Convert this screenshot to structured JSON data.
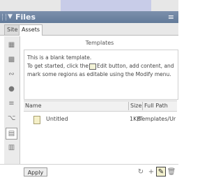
{
  "panel": {
    "title": "Files",
    "expand_arrow": "▼",
    "options_icon": "≡"
  },
  "tabs": [
    {
      "label": "Site"
    },
    {
      "label": "Assets"
    }
  ],
  "categories": [
    {
      "icon": "images-icon"
    },
    {
      "icon": "colors-icon"
    },
    {
      "icon": "urls-icon"
    },
    {
      "icon": "flash-icon"
    },
    {
      "icon": "movies-icon"
    },
    {
      "icon": "scripts-icon"
    },
    {
      "icon": "templates-icon"
    },
    {
      "icon": "library-icon"
    }
  ],
  "content": {
    "title": "Templates",
    "preview_lines": [
      "This is a blank template.",
      "To get started, click the",
      "Edit button, add content, and",
      "mark some regions as editable using the Modify menu."
    ],
    "columns": {
      "name": "Name",
      "size": "Size",
      "path": "Full Path"
    },
    "rows": [
      {
        "name": "Untitled",
        "size": "1KB",
        "path": "/Templates/Ur"
      }
    ]
  },
  "bottom": {
    "apply_label": "Apply",
    "refresh_glyph": "↻",
    "new_glyph": "+",
    "edit_glyph": "✎",
    "delete_glyph": "🗑"
  }
}
